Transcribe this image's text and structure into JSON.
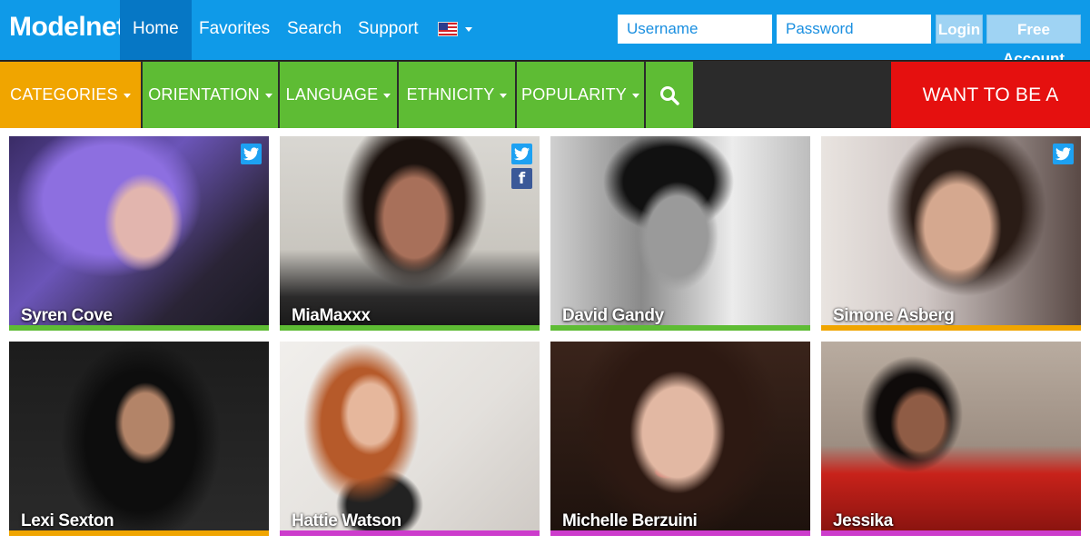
{
  "header": {
    "brand": "Modelnet",
    "nav": [
      {
        "label": "Home"
      },
      {
        "label": "Favorites"
      },
      {
        "label": "Search"
      },
      {
        "label": "Support"
      }
    ],
    "language_icon": "us-flag-icon",
    "login": {
      "username_placeholder": "Username",
      "password_placeholder": "Password",
      "login_label": "Login",
      "free_account_label": "Free Account"
    }
  },
  "categories": {
    "items": [
      {
        "label": "CATEGORIES",
        "color": "#f0a500"
      },
      {
        "label": "ORIENTATION",
        "color": "#5ebc34"
      },
      {
        "label": "LANGUAGE",
        "color": "#5ebc34"
      },
      {
        "label": "ETHNICITY",
        "color": "#5ebc34"
      },
      {
        "label": "POPULARITY",
        "color": "#5ebc34"
      }
    ],
    "search_icon": "search-icon",
    "cta": {
      "label": "WANT TO BE A MODEL?",
      "color": "#e5100f"
    }
  },
  "models": [
    {
      "name": "Syren Cove",
      "bar_color": "#5ebc34",
      "socials": [
        "twitter"
      ]
    },
    {
      "name": "MiaMaxxx",
      "bar_color": "#5ebc34",
      "socials": [
        "twitter",
        "facebook"
      ]
    },
    {
      "name": "David Gandy",
      "bar_color": "#5ebc34",
      "socials": []
    },
    {
      "name": "Simone Asberg",
      "bar_color": "#f0a500",
      "socials": [
        "twitter"
      ]
    },
    {
      "name": "Lexi Sexton",
      "bar_color": "#f0a500",
      "socials": []
    },
    {
      "name": "Hattie Watson",
      "bar_color": "#cc3ccc",
      "socials": []
    },
    {
      "name": "Michelle Berzuini",
      "bar_color": "#cc3ccc",
      "socials": []
    },
    {
      "name": "Jessika",
      "bar_color": "#cc3ccc",
      "socials": []
    }
  ]
}
